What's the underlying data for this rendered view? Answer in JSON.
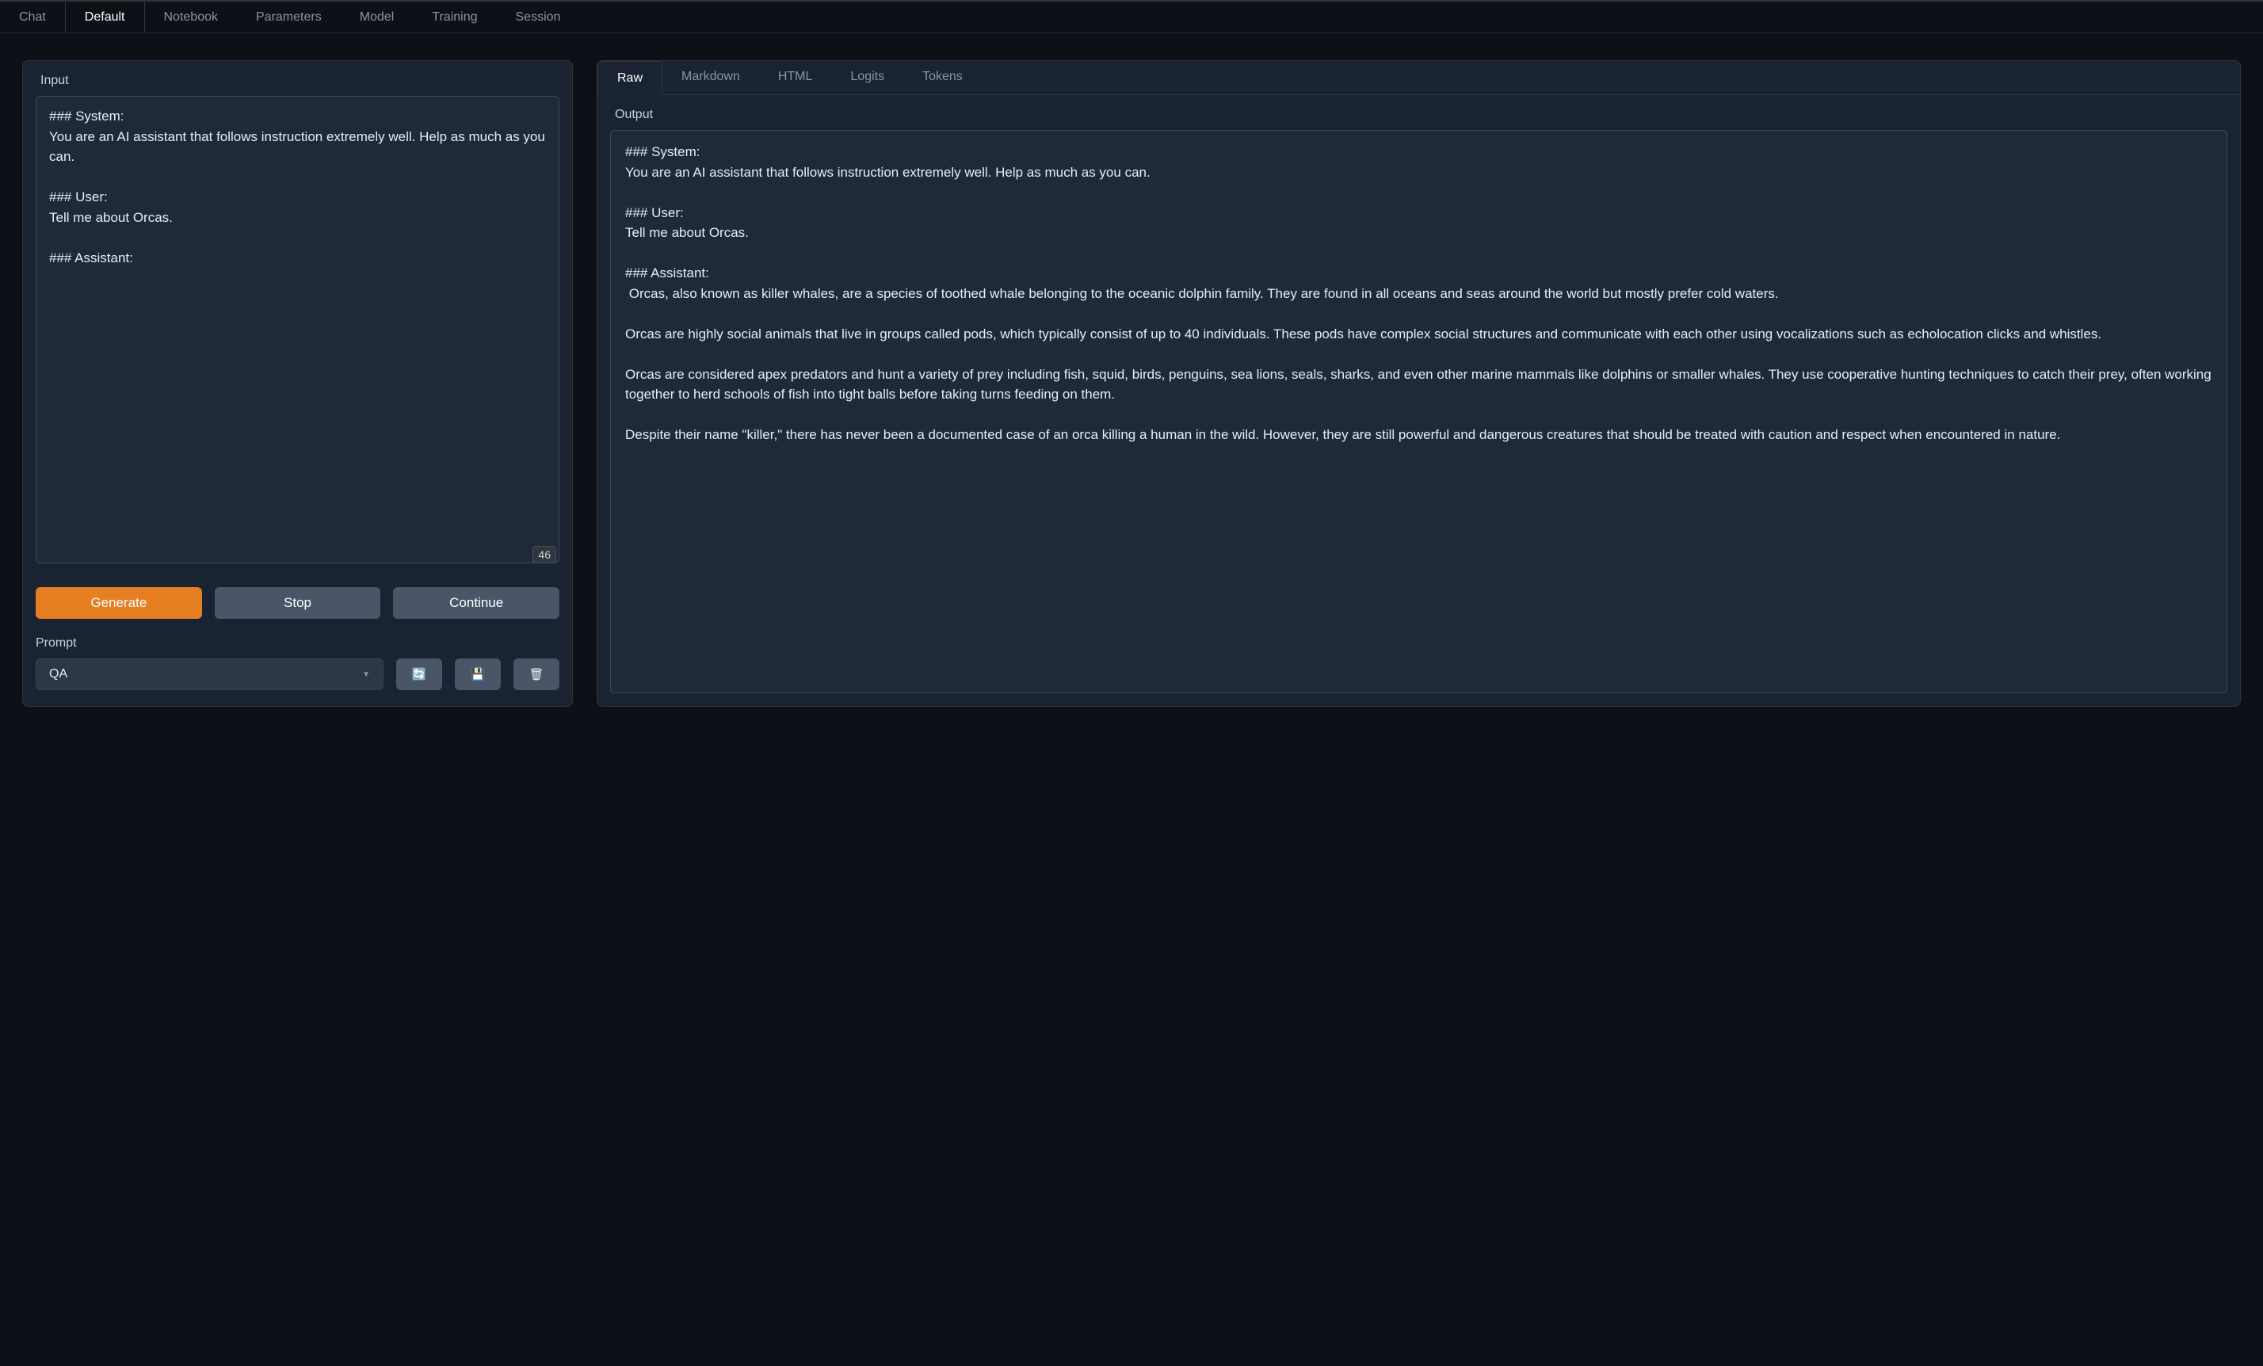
{
  "top_nav": {
    "tabs": [
      {
        "label": "Chat",
        "active": false
      },
      {
        "label": "Default",
        "active": true
      },
      {
        "label": "Notebook",
        "active": false
      },
      {
        "label": "Parameters",
        "active": false
      },
      {
        "label": "Model",
        "active": false
      },
      {
        "label": "Training",
        "active": false
      },
      {
        "label": "Session",
        "active": false
      }
    ]
  },
  "input_panel": {
    "label": "Input",
    "text": "### System:\nYou are an AI assistant that follows instruction extremely well. Help as much as you can.\n\n### User:\nTell me about Orcas.\n\n### Assistant:",
    "token_count": "46"
  },
  "buttons": {
    "generate": "Generate",
    "stop": "Stop",
    "continue": "Continue"
  },
  "prompt_section": {
    "label": "Prompt",
    "selected": "QA"
  },
  "output_panel": {
    "tabs": [
      {
        "label": "Raw",
        "active": true
      },
      {
        "label": "Markdown",
        "active": false
      },
      {
        "label": "HTML",
        "active": false
      },
      {
        "label": "Logits",
        "active": false
      },
      {
        "label": "Tokens",
        "active": false
      }
    ],
    "label": "Output",
    "text": "### System:\nYou are an AI assistant that follows instruction extremely well. Help as much as you can.\n\n### User:\nTell me about Orcas.\n\n### Assistant:\n Orcas, also known as killer whales, are a species of toothed whale belonging to the oceanic dolphin family. They are found in all oceans and seas around the world but mostly prefer cold waters.\n\nOrcas are highly social animals that live in groups called pods, which typically consist of up to 40 individuals. These pods have complex social structures and communicate with each other using vocalizations such as echolocation clicks and whistles.\n\nOrcas are considered apex predators and hunt a variety of prey including fish, squid, birds, penguins, sea lions, seals, sharks, and even other marine mammals like dolphins or smaller whales. They use cooperative hunting techniques to catch their prey, often working together to herd schools of fish into tight balls before taking turns feeding on them.\n\nDespite their name \"killer,\" there has never been a documented case of an orca killing a human in the wild. However, they are still powerful and dangerous creatures that should be treated with caution and respect when encountered in nature."
  }
}
